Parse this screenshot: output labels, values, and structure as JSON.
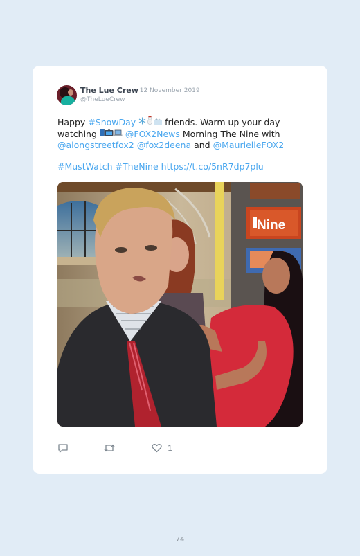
{
  "tweet": {
    "author_name": "The Lue Crew",
    "date": "· 12 November 2019",
    "handle": "@TheLueCrew",
    "line1_a": "Happy ",
    "line1_hashtag": "#SnowDay",
    "line1_b": " friends. Warm up your day",
    "line2_a": "watching ",
    "line2_mention": "@FOX2News",
    "line2_b": " Morning The Nine with",
    "line3_mention1": "@alongstreetfox2",
    "line3_mention2": "@fox2deena",
    "line3_and": " and ",
    "line3_mention3": "@MaurielleFOX2",
    "line4_hashtag1": "#MustWatch",
    "line4_hashtag2": "#TheNine",
    "line4_link": "https://t.co/5nR7dp7plu",
    "photo_sign_text": "Nine",
    "like_count": "1"
  },
  "icons": {
    "reply": "reply-icon",
    "retweet": "retweet-icon",
    "like": "heart-icon",
    "snowflake": "snowflake-icon",
    "snowman": "snowman-icon",
    "tv": "tv-icon",
    "laptop": "laptop-icon"
  },
  "colors": {
    "background": "#e1ecf6",
    "card": "#ffffff",
    "link": "#4aa7ef"
  },
  "page": {
    "number": "74"
  }
}
